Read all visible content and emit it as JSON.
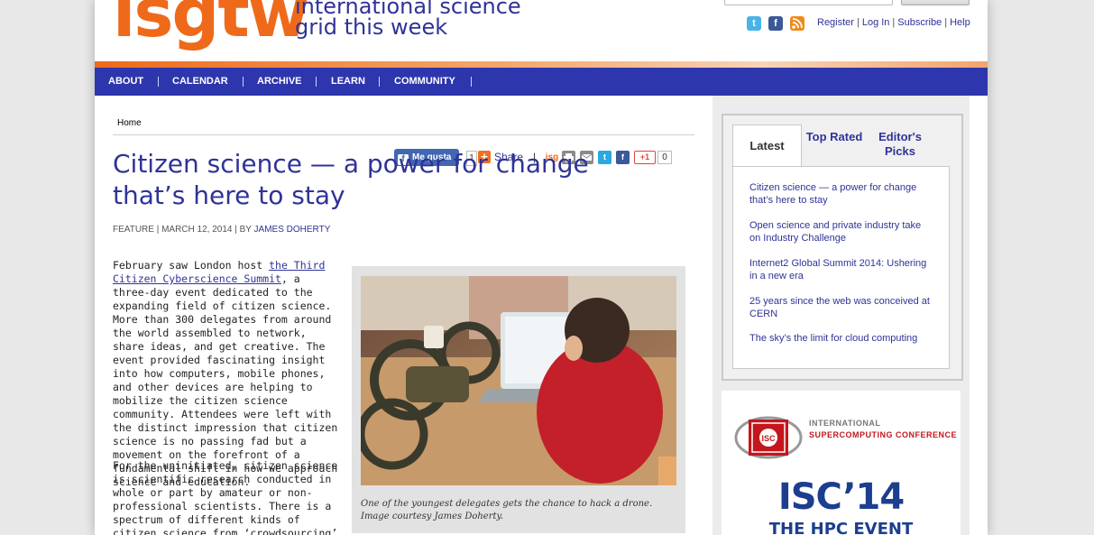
{
  "header": {
    "logo": "isgtw",
    "tagline_line1": "international science",
    "tagline_line2": "grid this week",
    "links": [
      "Register",
      "Log In",
      "Subscribe",
      "Help"
    ]
  },
  "nav": [
    "ABOUT",
    "CALENDAR",
    "ARCHIVE",
    "LEARN",
    "COMMUNITY"
  ],
  "breadcrumb": "Home",
  "article": {
    "title": "Citizen science — a power for change that’s here to stay",
    "meta_prefix": "FEATURE | MARCH 12, 2014 | BY ",
    "author": "JAMES DOHERTY",
    "p1_before": "February saw London host ",
    "p1_link": "the Third Citizen Cyberscience Summit",
    "p1_after": ", a three-day event dedicated to the expanding field of citizen science. More than 300 delegates from around the world assembled to network, share ideas, and get creative. The event provided fascinating insight into how computers, mobile phones, and other devices are helping to mobilize the citizen science community. Attendees were left with the distinct impression that citizen science is no passing fad but a movement on the forefront of a fundamental shift in how we approach science and education.",
    "p2": "For the uninitiated, citizen science is scientific research conducted in whole or part by amateur or non-professional scientists. There is a spectrum of different kinds of citizen science from ‘crowdsourcing’ in which citizens analyze",
    "caption": "One of the youngest delegates gets the chance to hack a drone. Image courtesy James Doherty."
  },
  "share": {
    "like_label": "Me gusta",
    "like_count": "1",
    "share_label": "Share",
    "gplus_label": "+1",
    "gplus_count": "0",
    "isg_label": "isg"
  },
  "sidebar": {
    "tabs": [
      "Latest",
      "Top Rated",
      "Editor's Picks"
    ],
    "stories": [
      "Citizen science — a power for change that’s here to stay",
      "Open science and private industry take on Industry Challenge",
      "Internet2 Global Summit 2014: Ushering in a new era",
      "25 years since the web was conceived at CERN",
      "The sky’s the limit for cloud computing"
    ],
    "ad": {
      "logo_text": "ISC",
      "name_line1": "INTERNATIONAL",
      "name_line2": "SUPERCOMPUTING CONFERENCE",
      "big": "ISC’14",
      "sub": "THE HPC EVENT"
    }
  },
  "colors": {
    "brand_orange": "#ee6a1a",
    "brand_blue": "#2f3397",
    "nav_blue": "#2e36ad"
  }
}
